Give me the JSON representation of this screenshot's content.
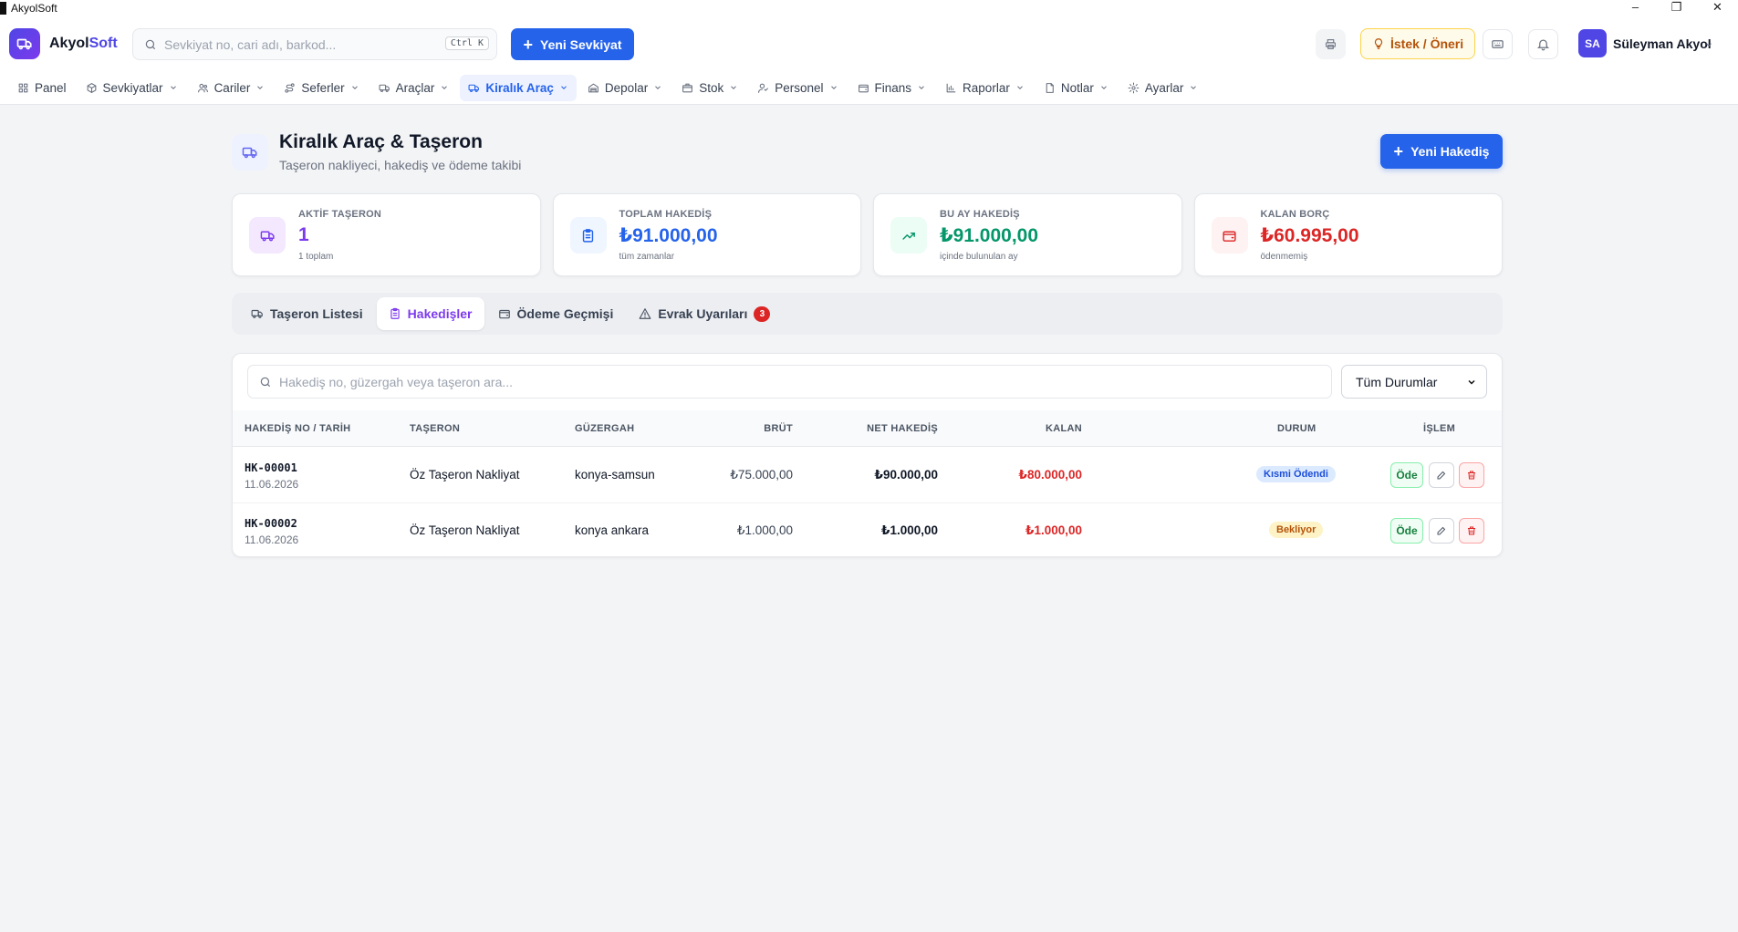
{
  "os": {
    "title": "AkyolSoft",
    "controls": [
      "–",
      "❐",
      "✕"
    ]
  },
  "header": {
    "brand_a": "Akyol",
    "brand_b": "Soft",
    "search_placeholder": "Sevkiyat no, cari adı, barkod...",
    "search_shortcut": "Ctrl K",
    "new_shipment": "Yeni Sevkiyat",
    "request_label": "İstek / Öneri",
    "user_initials": "SA",
    "user_name": "Süleyman Akyol"
  },
  "nav": [
    {
      "label": "Panel",
      "icon": "grid-icon",
      "dropdown": false
    },
    {
      "label": "Sevkiyatlar",
      "icon": "box-icon",
      "dropdown": true
    },
    {
      "label": "Cariler",
      "icon": "users-icon",
      "dropdown": true
    },
    {
      "label": "Seferler",
      "icon": "route-icon",
      "dropdown": true
    },
    {
      "label": "Araçlar",
      "icon": "truck-icon",
      "dropdown": true
    },
    {
      "label": "Kiralık Araç",
      "icon": "truck-icon",
      "dropdown": true,
      "active": true
    },
    {
      "label": "Depolar",
      "icon": "warehouse-icon",
      "dropdown": true
    },
    {
      "label": "Stok",
      "icon": "package-icon",
      "dropdown": true
    },
    {
      "label": "Personel",
      "icon": "user-icon",
      "dropdown": true
    },
    {
      "label": "Finans",
      "icon": "wallet-icon",
      "dropdown": true
    },
    {
      "label": "Raporlar",
      "icon": "chart-icon",
      "dropdown": true
    },
    {
      "label": "Notlar",
      "icon": "note-icon",
      "dropdown": true
    },
    {
      "label": "Ayarlar",
      "icon": "gear-icon",
      "dropdown": true
    }
  ],
  "page": {
    "title": "Kiralık Araç & Taşeron",
    "subtitle": "Taşeron nakliyeci, hakediş ve ödeme takibi",
    "new_button": "Yeni Hakediş"
  },
  "stats": [
    {
      "label": "AKTİF TAŞERON",
      "value": "1",
      "sub": "1 toplam",
      "color": "#7c3aed",
      "bg": "#f3e8ff",
      "icon": "truck-icon"
    },
    {
      "label": "TOPLAM HAKEDİŞ",
      "value": "₺91.000,00",
      "sub": "tüm zamanlar",
      "color": "#2563eb",
      "bg": "#eff6ff",
      "icon": "clipboard-icon"
    },
    {
      "label": "BU AY HAKEDİŞ",
      "value": "₺91.000,00",
      "sub": "içinde bulunulan ay",
      "color": "#059669",
      "bg": "#ecfdf5",
      "icon": "trend-up-icon"
    },
    {
      "label": "KALAN BORÇ",
      "value": "₺60.995,00",
      "sub": "ödenmemiş",
      "color": "#dc2626",
      "bg": "#fef2f2",
      "icon": "wallet-icon"
    }
  ],
  "tabs": [
    {
      "label": "Taşeron Listesi",
      "icon": "truck-icon"
    },
    {
      "label": "Hakedişler",
      "icon": "clipboard-icon",
      "active": true
    },
    {
      "label": "Ödeme Geçmişi",
      "icon": "wallet-icon"
    },
    {
      "label": "Evrak Uyarıları",
      "icon": "warning-icon",
      "badge": "3"
    }
  ],
  "table": {
    "search_placeholder": "Hakediş no, güzergah veya taşeron ara...",
    "filter_value": "Tüm Durumlar",
    "columns": [
      "HAKEDİŞ NO / TARİH",
      "TAŞERON",
      "GÜZERGAH",
      "BRÜT",
      "NET HAKEDİŞ",
      "KALAN",
      "DURUM",
      "İŞLEM"
    ],
    "rows": [
      {
        "no": "HK-00001",
        "date": "11.06.2026",
        "contractor": "Öz Taşeron Nakliyat",
        "route": "konya-samsun",
        "gross": "₺75.000,00",
        "net": "₺90.000,00",
        "remaining": "₺80.000,00",
        "status": "Kısmi Ödendi",
        "status_kind": "partial",
        "pay": "Öde"
      },
      {
        "no": "HK-00002",
        "date": "11.06.2026",
        "contractor": "Öz Taşeron Nakliyat",
        "route": "konya ankara",
        "gross": "₺1.000,00",
        "net": "₺1.000,00",
        "remaining": "₺1.000,00",
        "status": "Bekliyor",
        "status_kind": "pending",
        "pay": "Öde"
      }
    ]
  }
}
